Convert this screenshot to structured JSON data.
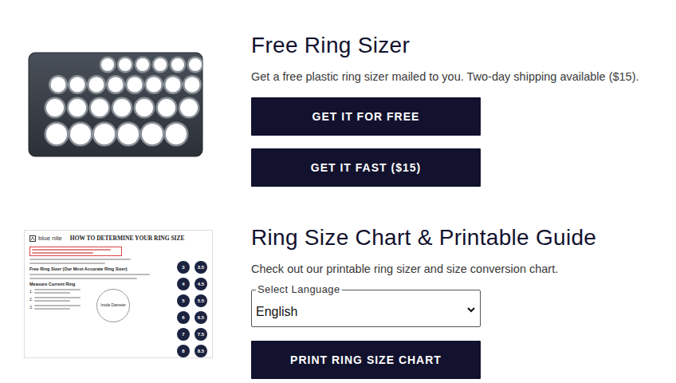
{
  "free_ring_sizer": {
    "title": "Free Ring Sizer",
    "description": "Get a free plastic ring sizer mailed to you. Two-day shipping available ($15).",
    "buttons": [
      "GET IT FOR FREE",
      "GET IT FAST ($15)"
    ]
  },
  "size_chart": {
    "title": "Ring Size Chart & Printable Guide",
    "description": "Check out our printable ring sizer and size conversion chart.",
    "language_select": {
      "label": "Select Language",
      "value": "English"
    },
    "button": "PRINT RING SIZE CHART",
    "guide_preview": {
      "brand": "blue nile",
      "heading": "HOW TO DETERMINE YOUR RING SIZE",
      "sections": [
        "Free Ring Sizer (Our Most Accurate Ring Sizer)",
        "Measure Current Ring"
      ],
      "steps": [
        "1.",
        "2.",
        "3."
      ],
      "diagram_label": "Inside Diameter",
      "sizes": [
        "3",
        "3.5",
        "4",
        "4.5",
        "5",
        "5.5",
        "6",
        "6.5",
        "7",
        "7.5",
        "8",
        "8.5"
      ]
    }
  }
}
